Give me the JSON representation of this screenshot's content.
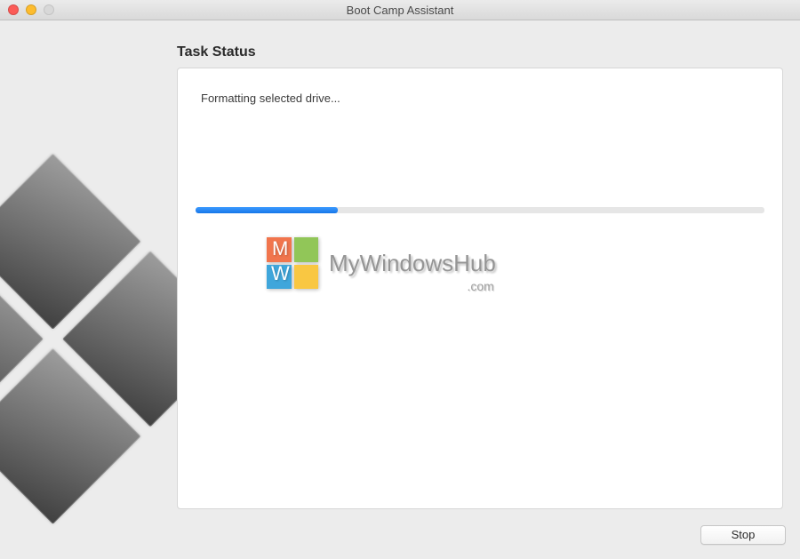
{
  "window": {
    "title": "Boot Camp Assistant"
  },
  "heading": "Task Status",
  "status_text": "Formatting selected drive...",
  "progress": {
    "percent": 25
  },
  "footer": {
    "stop_label": "Stop"
  },
  "watermark": {
    "text": "MyWindowsHub",
    "sub": ".com",
    "letter1": "M",
    "letter2": "W"
  },
  "colors": {
    "accent": "#1676e8"
  }
}
